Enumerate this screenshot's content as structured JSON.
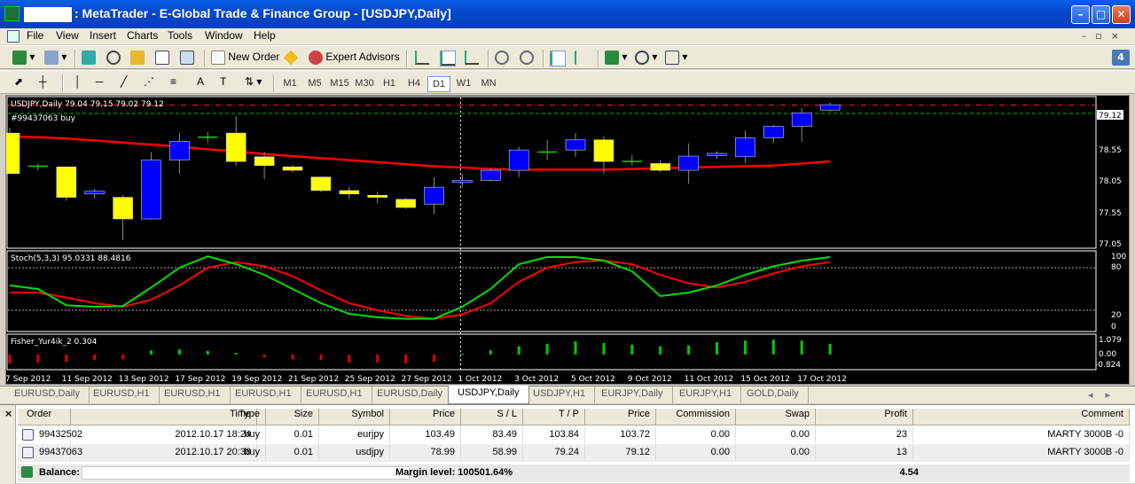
{
  "window": {
    "title": ": MetaTrader - E-Global Trade & Finance Group - [USDJPY,Daily]"
  },
  "menu": [
    "File",
    "View",
    "Insert",
    "Charts",
    "Tools",
    "Window",
    "Help"
  ],
  "toolbar": {
    "new_order": "New Order",
    "expert_advisors": "Expert Advisors",
    "badge": "4"
  },
  "timeframes": [
    "M1",
    "M5",
    "M15",
    "M30",
    "H1",
    "H4",
    "D1",
    "W1",
    "MN"
  ],
  "active_timeframe": "D1",
  "chart": {
    "header": "USDJPY,Daily  79.04 79.15 79.02 79.12",
    "order_label": "#99437063 buy",
    "price_box": "79.12",
    "price_ticks": [
      "78.55",
      "78.05",
      "77.55",
      "77.05"
    ],
    "stoch_label": "Stoch(5,3,3) 95.0331 88.4816",
    "stoch_ticks": [
      "100",
      "80",
      "20",
      "0"
    ],
    "fisher_label": "Fisher_Yur4ik_2 0.304",
    "fisher_ticks": [
      "1.079",
      "0.00",
      "-0.824"
    ],
    "date_ticks": [
      "7 Sep 2012",
      "11 Sep 2012",
      "13 Sep 2012",
      "17 Sep 2012",
      "19 Sep 2012",
      "21 Sep 2012",
      "25 Sep 2012",
      "27 Sep 2012",
      "1 Oct 2012",
      "3 Oct 2012",
      "5 Oct 2012",
      "9 Oct 2012",
      "11 Oct 2012",
      "15 Oct 2012",
      "17 Oct 2012"
    ],
    "colors": {
      "bull": "#0000ff",
      "bear": "#ffff00",
      "ma": "#ff0000",
      "stoch_main": "#00dd00",
      "stoch_signal": "#ff0000"
    }
  },
  "chart_data": {
    "type": "candlestick",
    "symbol": "USDJPY,Daily",
    "candles": [
      {
        "o": 78.7,
        "h": 78.78,
        "l": 78.1,
        "c": 78.1
      },
      {
        "o": 78.2,
        "h": 78.25,
        "l": 78.15,
        "c": 78.21
      },
      {
        "o": 78.2,
        "h": 78.2,
        "l": 77.7,
        "c": 77.75
      },
      {
        "o": 77.8,
        "h": 77.88,
        "l": 77.73,
        "c": 77.84
      },
      {
        "o": 77.75,
        "h": 77.78,
        "l": 77.12,
        "c": 77.43
      },
      {
        "o": 77.43,
        "h": 78.42,
        "l": 77.42,
        "c": 78.3
      },
      {
        "o": 78.3,
        "h": 78.7,
        "l": 78.1,
        "c": 78.58
      },
      {
        "o": 78.62,
        "h": 78.72,
        "l": 78.55,
        "c": 78.64
      },
      {
        "o": 78.7,
        "h": 78.95,
        "l": 78.22,
        "c": 78.28
      },
      {
        "o": 78.35,
        "h": 78.42,
        "l": 78.02,
        "c": 78.22
      },
      {
        "o": 78.2,
        "h": 78.23,
        "l": 78.12,
        "c": 78.15
      },
      {
        "o": 78.05,
        "h": 78.05,
        "l": 77.83,
        "c": 77.85
      },
      {
        "o": 77.85,
        "h": 77.91,
        "l": 77.72,
        "c": 77.8
      },
      {
        "o": 77.78,
        "h": 77.83,
        "l": 77.66,
        "c": 77.75
      },
      {
        "o": 77.72,
        "h": 77.74,
        "l": 77.58,
        "c": 77.6
      },
      {
        "o": 77.65,
        "h": 78.05,
        "l": 77.5,
        "c": 77.9
      },
      {
        "o": 77.97,
        "h": 78.1,
        "l": 77.9,
        "c": 78.0
      },
      {
        "o": 78.0,
        "h": 78.18,
        "l": 77.98,
        "c": 78.15
      },
      {
        "o": 78.15,
        "h": 78.5,
        "l": 78.05,
        "c": 78.45
      },
      {
        "o": 78.42,
        "h": 78.6,
        "l": 78.3,
        "c": 78.42
      },
      {
        "o": 78.45,
        "h": 78.7,
        "l": 78.35,
        "c": 78.6
      },
      {
        "o": 78.6,
        "h": 78.65,
        "l": 78.1,
        "c": 78.28
      },
      {
        "o": 78.28,
        "h": 78.38,
        "l": 78.22,
        "c": 78.26
      },
      {
        "o": 78.25,
        "h": 78.3,
        "l": 78.12,
        "c": 78.15
      },
      {
        "o": 78.15,
        "h": 78.55,
        "l": 77.95,
        "c": 78.36
      },
      {
        "o": 78.37,
        "h": 78.43,
        "l": 78.32,
        "c": 78.4
      },
      {
        "o": 78.35,
        "h": 78.73,
        "l": 78.25,
        "c": 78.63
      },
      {
        "o": 78.63,
        "h": 78.82,
        "l": 78.55,
        "c": 78.8
      },
      {
        "o": 78.8,
        "h": 79.07,
        "l": 78.57,
        "c": 79.0
      },
      {
        "o": 79.04,
        "h": 79.15,
        "l": 79.02,
        "c": 79.12
      }
    ],
    "ma": [
      78.65,
      78.64,
      78.62,
      78.59,
      78.56,
      78.53,
      78.5,
      78.46,
      78.43,
      78.39,
      78.36,
      78.33,
      78.3,
      78.27,
      78.24,
      78.21,
      78.19,
      78.17,
      78.16,
      78.16,
      78.16,
      78.16,
      78.17,
      78.18,
      78.19,
      78.2,
      78.21,
      78.22,
      78.25,
      78.28
    ],
    "stoch_main": [
      55,
      50,
      27,
      25,
      26,
      52,
      80,
      96,
      85,
      70,
      50,
      30,
      15,
      10,
      8,
      8,
      25,
      50,
      85,
      95,
      95,
      90,
      75,
      40,
      45,
      55,
      70,
      82,
      90,
      95
    ],
    "stoch_signal": [
      45,
      45,
      38,
      30,
      25,
      35,
      55,
      80,
      88,
      82,
      68,
      48,
      30,
      20,
      12,
      8,
      14,
      30,
      60,
      80,
      88,
      90,
      85,
      70,
      58,
      52,
      60,
      72,
      82,
      88
    ],
    "fisher": [
      -0.55,
      -0.5,
      -0.45,
      -0.35,
      -0.3,
      0.25,
      0.3,
      0.22,
      0.1,
      -0.2,
      -0.3,
      -0.35,
      -0.5,
      -0.5,
      -0.55,
      -0.45,
      0.05,
      0.25,
      0.5,
      0.65,
      0.8,
      0.7,
      0.6,
      0.5,
      0.55,
      0.75,
      0.85,
      0.9,
      0.85,
      0.65
    ],
    "price_range": [
      77.05,
      79.2
    ],
    "stoch_range": [
      0,
      100
    ],
    "fisher_range": [
      -0.824,
      1.079
    ]
  },
  "chart_tabs": [
    "EURUSD,Daily",
    "EURUSD,H1",
    "EURUSD,H1",
    "EURUSD,H1",
    "EURUSD,H1",
    "EURUSD,Daily",
    "USDJPY,Daily",
    "USDJPY,H1",
    "EURJPY,Daily",
    "EURJPY,H1",
    "GOLD,Daily"
  ],
  "active_tab": 6,
  "terminal": {
    "columns": [
      "Order",
      "Time",
      "Type",
      "Size",
      "Symbol",
      "Price",
      "S / L",
      "T / P",
      "Price",
      "Commission",
      "Swap",
      "Profit",
      "Comment"
    ],
    "rows": [
      [
        "99432502",
        "2012.10.17 18:24",
        "buy",
        "0.01",
        "eurjpy",
        "103.49",
        "83.49",
        "103.84",
        "103.72",
        "0.00",
        "0.00",
        "23",
        "MARTY 3000B -0"
      ],
      [
        "99437063",
        "2012.10.17 20:38",
        "buy",
        "0.01",
        "usdjpy",
        "78.99",
        "58.99",
        "79.24",
        "79.12",
        "0.00",
        "0.00",
        "13",
        "MARTY 3000B -0"
      ]
    ],
    "balance_label": "Balance:",
    "margin_level": "Margin level: 100501.64%",
    "total_profit": "4.54"
  }
}
